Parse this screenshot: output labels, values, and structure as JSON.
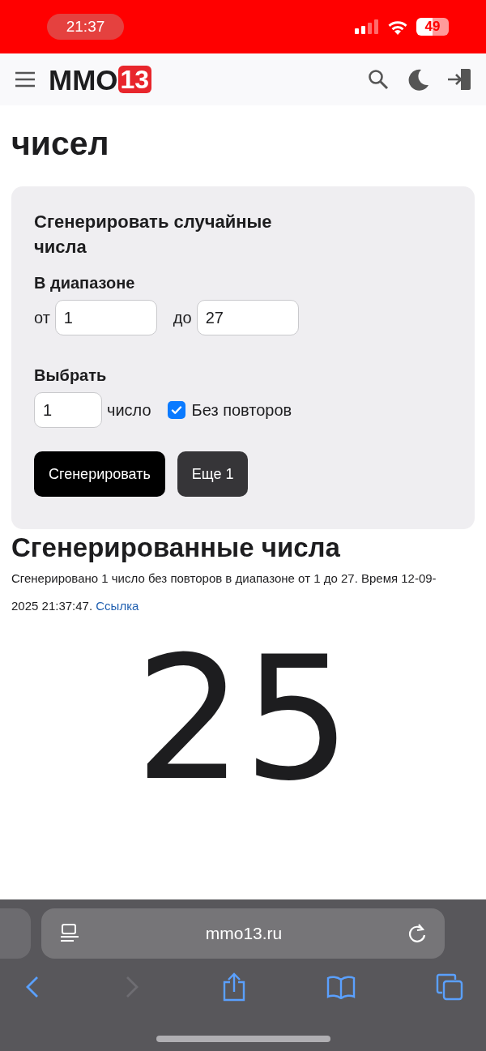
{
  "status_bar": {
    "time": "21:37",
    "battery": "49"
  },
  "header": {
    "logo_text": "ММО",
    "logo_badge": "13"
  },
  "page_title": "чисел",
  "form": {
    "title": "Сгенерировать случайные числа",
    "range_label": "В диапазоне",
    "from_label": "от",
    "from_value": "1",
    "to_label": "до",
    "to_value": "27",
    "pick_label": "Выбрать",
    "count_value": "1",
    "count_unit": "число",
    "no_repeat": {
      "label": "Без повторов",
      "checked": true
    },
    "buttons": [
      {
        "label": "Сгенерировать",
        "kind": "primary"
      },
      {
        "label": "Еще 1",
        "kind": "secondary"
      }
    ]
  },
  "result": {
    "heading": "Сгенерированные числа",
    "description": "Сгенерировано 1 число без повторов в диапазоне от 1 до 27. Время 12-09-2025 21:37:47.",
    "link": "Ссылка",
    "numbers": [
      "25"
    ]
  },
  "browser": {
    "url": "mmo13.ru"
  }
}
